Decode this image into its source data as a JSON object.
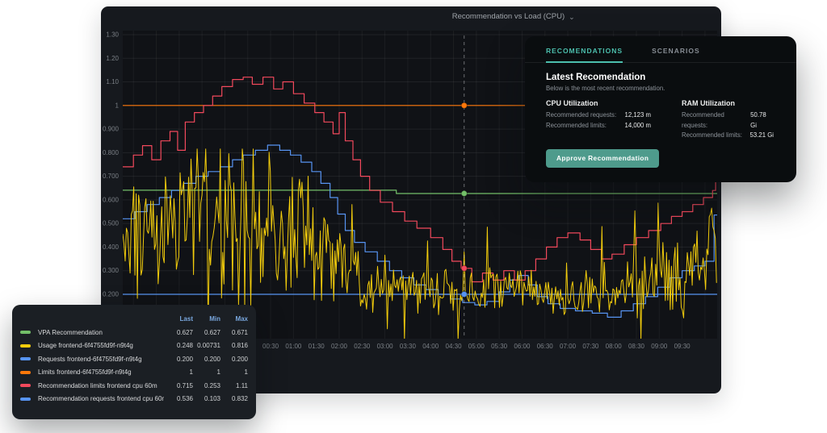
{
  "colors": {
    "accent": "#4CBFAD",
    "approve_button": "#4E9B8C",
    "legend_header": "#79A7DE",
    "panel_bg": "#16191E",
    "card_bg": "#0A0D0F",
    "legend_bg": "#1B1F24"
  },
  "panel": {
    "title": "Recommendation vs Load (CPU)"
  },
  "icons": {
    "chevron_down": "⌄"
  },
  "legend": {
    "columns": [
      "Last",
      "Min",
      "Max"
    ],
    "rows": [
      {
        "label": "VPA Recommendation",
        "color": "#73BF69",
        "last": "0.627",
        "min": "0.627",
        "max": "0.671"
      },
      {
        "label": "Usage frontend-6f4755fd9f-n9t4g",
        "color": "#F2CC0C",
        "last": "0.248",
        "min": "0.00731",
        "max": "0.816"
      },
      {
        "label": "Requests frontend-6f4755fd9f-n9t4g",
        "color": "#5794F2",
        "last": "0.200",
        "min": "0.200",
        "max": "0.200"
      },
      {
        "label": "Limits frontend-6f4755fd9f-n9t4g",
        "color": "#FF780A",
        "last": "1",
        "min": "1",
        "max": "1"
      },
      {
        "label": "Recommendation limits frontend cpu 60m",
        "color": "#F2495C",
        "last": "0.715",
        "min": "0.253",
        "max": "1.11"
      },
      {
        "label": "Recommendation requests frontend cpu 60m",
        "color": "#5794F2",
        "last": "0.536",
        "min": "0.103",
        "max": "0.832"
      }
    ]
  },
  "card": {
    "tabs": [
      {
        "label": "RECOMENDATIONS",
        "active": true
      },
      {
        "label": "SCENARIOS",
        "active": false
      }
    ],
    "heading": "Latest Recomendation",
    "subheading": "Below is the most recent recommendation.",
    "sections": [
      {
        "title": "CPU Utilization",
        "rows": [
          {
            "label": "Recommended requests:",
            "value": "12,123 m"
          },
          {
            "label": "Recommended limits:",
            "value": "14,000 m"
          }
        ]
      },
      {
        "title": "RAM Utilization",
        "rows": [
          {
            "label": "Recommended requests:",
            "value": "50.78 Gi"
          },
          {
            "label": "Recommended limits:",
            "value": "53.21 Gi"
          }
        ]
      }
    ],
    "approve_label": "Approve Recommendation"
  },
  "chart_data": {
    "type": "line",
    "title": "Recommendation vs Load (CPU)",
    "grid": true,
    "x_axis": {
      "unit": "time",
      "domain_minutes": [
        -164,
        616
      ],
      "tick_minutes": [
        30,
        60,
        90,
        120,
        150,
        180,
        210,
        240,
        270,
        300,
        330,
        360,
        390,
        420,
        450,
        480,
        510,
        540,
        570
      ],
      "tick_labels": [
        "00:30",
        "01:00",
        "01:30",
        "02:00",
        "02:30",
        "03:00",
        "03:30",
        "04:00",
        "04:30",
        "05:00",
        "05:30",
        "06:00",
        "06:30",
        "07:00",
        "07:30",
        "08:00",
        "08:30",
        "09:00",
        "09:30"
      ],
      "grid_step_minutes": 30
    },
    "y_axis": {
      "unit": "cores",
      "domain": [
        0.012,
        1.317
      ],
      "tick_values": [
        1.3,
        1.2,
        1.1,
        1.0,
        0.9,
        0.8,
        0.7,
        0.6,
        0.5,
        0.4,
        0.3,
        0.2
      ],
      "tick_labels": [
        "1.30",
        "1.20",
        "1.10",
        "1",
        "0.900",
        "0.800",
        "0.700",
        "0.600",
        "0.500",
        "0.400",
        "0.300",
        "0.200"
      ]
    },
    "crosshair": {
      "minutes": 284,
      "markers": [
        {
          "series": "limits",
          "value": 1.0,
          "color": "#FF780A"
        },
        {
          "series": "vpa",
          "value": 0.627,
          "color": "#73BF69"
        },
        {
          "series": "rec_limits",
          "value": 0.31,
          "color": "#F2495C"
        },
        {
          "series": "requests",
          "value": 0.2,
          "color": "#5794F2"
        }
      ]
    },
    "series": [
      {
        "key": "requests",
        "name": "Requests frontend-6f4755fd9f-n9t4g",
        "color": "#5794F2",
        "type": "line",
        "points": [
          [
            -164,
            0.2
          ],
          [
            616,
            0.2
          ]
        ]
      },
      {
        "key": "limits",
        "name": "Limits frontend-6f4755fd9f-n9t4g",
        "color": "#FF780A",
        "type": "line",
        "points": [
          [
            -164,
            1
          ],
          [
            616,
            1
          ]
        ]
      },
      {
        "key": "vpa",
        "name": "VPA Recommendation",
        "color": "#73BF69",
        "type": "step",
        "points": [
          [
            -164,
            0.641
          ],
          [
            195,
            0.627
          ],
          [
            616,
            0.627
          ]
        ]
      },
      {
        "key": "rec_requests",
        "name": "Recommendation requests frontend cpu 60m",
        "color": "#5794F2",
        "type": "step",
        "points": [
          [
            -164,
            0.52
          ],
          [
            -148,
            0.55
          ],
          [
            -132,
            0.58
          ],
          [
            -116,
            0.61
          ],
          [
            -100,
            0.64
          ],
          [
            -84,
            0.67
          ],
          [
            -68,
            0.7
          ],
          [
            -52,
            0.72
          ],
          [
            -36,
            0.74
          ],
          [
            -20,
            0.77
          ],
          [
            -6,
            0.79
          ],
          [
            10,
            0.81
          ],
          [
            26,
            0.832
          ],
          [
            42,
            0.81
          ],
          [
            56,
            0.79
          ],
          [
            70,
            0.76
          ],
          [
            84,
            0.72
          ],
          [
            96,
            0.67
          ],
          [
            108,
            0.61
          ],
          [
            118,
            0.54
          ],
          [
            128,
            0.47
          ],
          [
            140,
            0.42
          ],
          [
            154,
            0.38
          ],
          [
            170,
            0.34
          ],
          [
            186,
            0.3
          ],
          [
            202,
            0.27
          ],
          [
            218,
            0.24
          ],
          [
            234,
            0.22
          ],
          [
            250,
            0.2
          ],
          [
            266,
            0.18
          ],
          [
            282,
            0.165
          ],
          [
            298,
            0.155
          ],
          [
            314,
            0.17
          ],
          [
            330,
            0.21
          ],
          [
            344,
            0.26
          ],
          [
            356,
            0.28
          ],
          [
            368,
            0.24
          ],
          [
            380,
            0.19
          ],
          [
            394,
            0.16
          ],
          [
            410,
            0.14
          ],
          [
            430,
            0.13
          ],
          [
            452,
            0.12
          ],
          [
            472,
            0.103
          ],
          [
            490,
            0.13
          ],
          [
            506,
            0.16
          ],
          [
            522,
            0.19
          ],
          [
            538,
            0.23
          ],
          [
            554,
            0.27
          ],
          [
            570,
            0.3
          ],
          [
            586,
            0.32
          ],
          [
            600,
            0.34
          ],
          [
            612,
            0.536
          ],
          [
            616,
            0.536
          ]
        ]
      },
      {
        "key": "rec_limits",
        "name": "Recommendation limits frontend cpu 60m",
        "color": "#F2495C",
        "type": "step",
        "points": [
          [
            -164,
            0.74
          ],
          [
            -150,
            0.79
          ],
          [
            -138,
            0.83
          ],
          [
            -126,
            0.77
          ],
          [
            -114,
            0.85
          ],
          [
            -102,
            0.89
          ],
          [
            -92,
            0.81
          ],
          [
            -82,
            0.93
          ],
          [
            -70,
            0.97
          ],
          [
            -58,
            1.0
          ],
          [
            -46,
            1.04
          ],
          [
            -34,
            1.08
          ],
          [
            -20,
            1.11
          ],
          [
            -6,
            1.12
          ],
          [
            6,
            1.09
          ],
          [
            20,
            1.12
          ],
          [
            34,
            1.07
          ],
          [
            46,
            1.1
          ],
          [
            60,
            1.05
          ],
          [
            74,
            1.01
          ],
          [
            88,
            0.97
          ],
          [
            100,
            0.93
          ],
          [
            112,
            0.88
          ],
          [
            120,
            0.97
          ],
          [
            128,
            0.85
          ],
          [
            138,
            0.77
          ],
          [
            148,
            0.7
          ],
          [
            160,
            0.64
          ],
          [
            174,
            0.59
          ],
          [
            190,
            0.55
          ],
          [
            206,
            0.51
          ],
          [
            222,
            0.48
          ],
          [
            240,
            0.44
          ],
          [
            256,
            0.39
          ],
          [
            268,
            0.34
          ],
          [
            280,
            0.31
          ],
          [
            294,
            0.253
          ],
          [
            308,
            0.29
          ],
          [
            322,
            0.26
          ],
          [
            336,
            0.3
          ],
          [
            350,
            0.26
          ],
          [
            364,
            0.3
          ],
          [
            378,
            0.35
          ],
          [
            392,
            0.4
          ],
          [
            406,
            0.44
          ],
          [
            420,
            0.46
          ],
          [
            436,
            0.43
          ],
          [
            450,
            0.39
          ],
          [
            464,
            0.35
          ],
          [
            478,
            0.37
          ],
          [
            494,
            0.41
          ],
          [
            510,
            0.44
          ],
          [
            526,
            0.47
          ],
          [
            542,
            0.5
          ],
          [
            556,
            0.53
          ],
          [
            570,
            0.55
          ],
          [
            584,
            0.58
          ],
          [
            598,
            0.61
          ],
          [
            610,
            0.64
          ],
          [
            614,
            0.715
          ],
          [
            616,
            0.715
          ]
        ]
      },
      {
        "key": "usage",
        "name": "Usage frontend-6f4755fd9f-n9t4g",
        "color": "#F2CC0C",
        "type": "noisy",
        "seed": 13,
        "sample_step_minutes": 1.6,
        "spike_chance": 0.07,
        "spike_gain": 2.4,
        "clamp": [
          0.007,
          0.816
        ],
        "mean_anchors": [
          [
            -164,
            0.4
          ],
          [
            -145,
            0.48
          ],
          [
            -120,
            0.52
          ],
          [
            -90,
            0.5
          ],
          [
            -60,
            0.53
          ],
          [
            -30,
            0.5
          ],
          [
            0,
            0.48
          ],
          [
            30,
            0.5
          ],
          [
            60,
            0.47
          ],
          [
            90,
            0.43
          ],
          [
            110,
            0.36
          ],
          [
            125,
            0.3
          ],
          [
            145,
            0.26
          ],
          [
            175,
            0.24
          ],
          [
            205,
            0.22
          ],
          [
            235,
            0.22
          ],
          [
            265,
            0.21
          ],
          [
            295,
            0.2
          ],
          [
            325,
            0.22
          ],
          [
            355,
            0.23
          ],
          [
            385,
            0.21
          ],
          [
            415,
            0.19
          ],
          [
            445,
            0.2
          ],
          [
            475,
            0.22
          ],
          [
            505,
            0.24
          ],
          [
            535,
            0.26
          ],
          [
            560,
            0.29
          ],
          [
            580,
            0.31
          ],
          [
            598,
            0.36
          ],
          [
            610,
            0.42
          ],
          [
            616,
            0.3
          ]
        ],
        "amp_anchors": [
          [
            -164,
            0.18
          ],
          [
            -130,
            0.22
          ],
          [
            -70,
            0.25
          ],
          [
            -10,
            0.26
          ],
          [
            50,
            0.24
          ],
          [
            95,
            0.21
          ],
          [
            115,
            0.15
          ],
          [
            140,
            0.11
          ],
          [
            200,
            0.09
          ],
          [
            260,
            0.08
          ],
          [
            320,
            0.09
          ],
          [
            380,
            0.08
          ],
          [
            440,
            0.08
          ],
          [
            500,
            0.1
          ],
          [
            545,
            0.12
          ],
          [
            575,
            0.14
          ],
          [
            600,
            0.16
          ],
          [
            616,
            0.12
          ]
        ],
        "forced_points": [
          [
            -7,
            0.816
          ],
          [
            205,
            0.00731
          ],
          [
            616,
            0.248
          ]
        ]
      }
    ]
  }
}
